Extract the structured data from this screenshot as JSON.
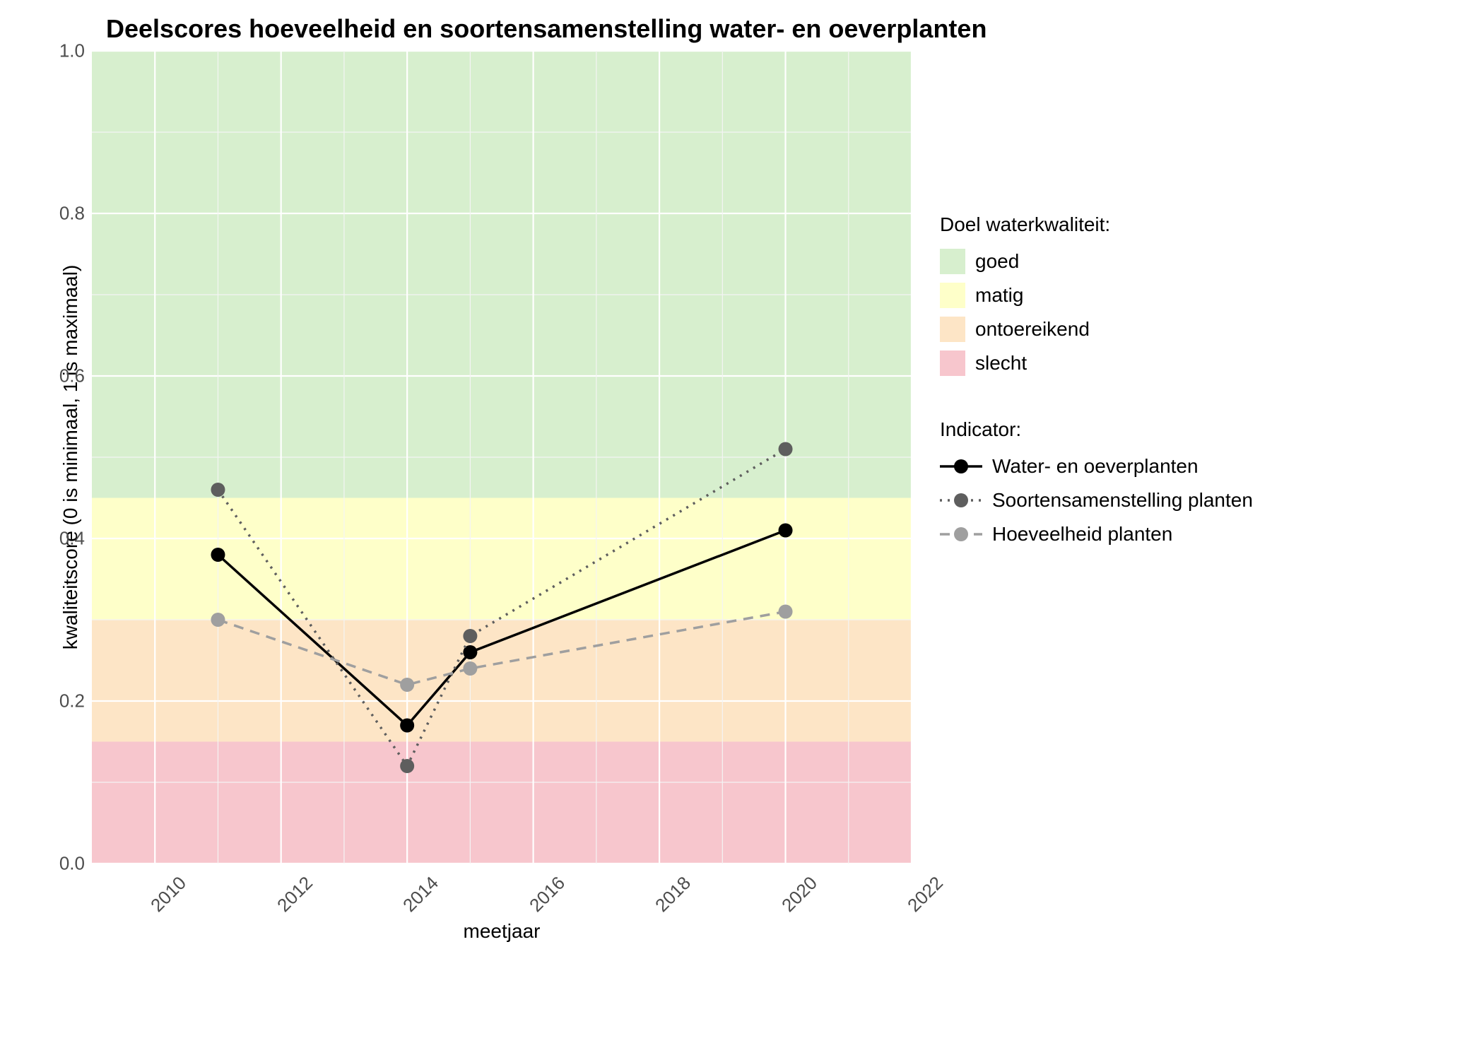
{
  "chart_data": {
    "type": "line",
    "title": "Deelscores hoeveelheid en soortensamenstelling water- en oeverplanten",
    "xlabel": "meetjaar",
    "ylabel": "kwaliteitscore (0 is minimaal, 1 is maximaal)",
    "xlim": [
      2009,
      2022
    ],
    "ylim": [
      0,
      1.0
    ],
    "x_ticks": [
      2010,
      2012,
      2014,
      2016,
      2018,
      2020,
      2022
    ],
    "y_ticks": [
      0.0,
      0.2,
      0.4,
      0.6,
      0.8,
      1.0
    ],
    "bands": [
      {
        "name": "slecht",
        "from": 0.0,
        "to": 0.15,
        "color": "#f7c6cd"
      },
      {
        "name": "ontoereikend",
        "from": 0.15,
        "to": 0.3,
        "color": "#fde5c6"
      },
      {
        "name": "matig",
        "from": 0.3,
        "to": 0.45,
        "color": "#feffc9"
      },
      {
        "name": "goed",
        "from": 0.45,
        "to": 1.0,
        "color": "#d7efce"
      }
    ],
    "series": [
      {
        "name": "Water- en oeverplanten",
        "x": [
          2011,
          2014,
          2015,
          2020
        ],
        "values": [
          0.38,
          0.17,
          0.26,
          0.41
        ],
        "color": "#000000",
        "dash": "solid"
      },
      {
        "name": "Soortensamenstelling planten",
        "x": [
          2011,
          2014,
          2015,
          2020
        ],
        "values": [
          0.46,
          0.12,
          0.28,
          0.51
        ],
        "color": "#5e5e5e",
        "dash": "dotted"
      },
      {
        "name": "Hoeveelheid planten",
        "x": [
          2011,
          2014,
          2015,
          2020
        ],
        "values": [
          0.3,
          0.22,
          0.24,
          0.31
        ],
        "color": "#9f9f9f",
        "dash": "dashed"
      }
    ],
    "legend_band_title": "Doel waterkwaliteit:",
    "legend_band_order": [
      "goed",
      "matig",
      "ontoereikend",
      "slecht"
    ],
    "legend_series_title": "Indicator:"
  }
}
